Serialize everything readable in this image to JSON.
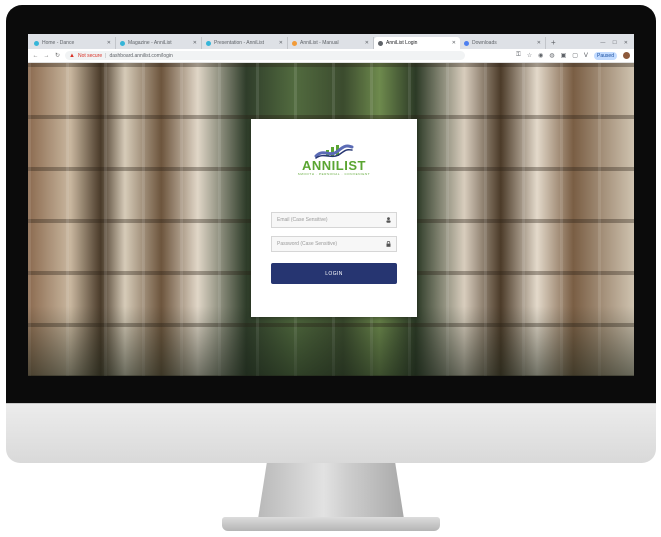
{
  "browser": {
    "tabs": [
      {
        "label": "Home - Dance",
        "favicon_color": "#36b5d8"
      },
      {
        "label": "Magazine - AnniList",
        "favicon_color": "#36b5d8"
      },
      {
        "label": "Presentation - AnniList",
        "favicon_color": "#36b5d8"
      },
      {
        "label": "AnniList - Manual",
        "favicon_color": "#f29b38"
      },
      {
        "label": "AnniList Login",
        "favicon_color": "#5f6368"
      },
      {
        "label": "Downloads",
        "favicon_color": "#4d7ff0"
      }
    ],
    "active_tab_index": 4,
    "new_tab_symbol": "+",
    "address": {
      "security_label": "Not secure",
      "url": "dashboard.annilist.com/login"
    },
    "profile_badge": "Paused"
  },
  "login": {
    "brand_name": "ANNILIST",
    "brand_tagline": "SMOOTH · PERSONAL · CONVENIENT",
    "email_placeholder": "Email (Case Sensitive)",
    "password_placeholder": "Password (Case Sensitive)",
    "login_button": "LOGIN"
  },
  "colors": {
    "brand_green": "#5aa531",
    "brand_navy": "#263571",
    "logo_accent": "#5b6bb5"
  }
}
